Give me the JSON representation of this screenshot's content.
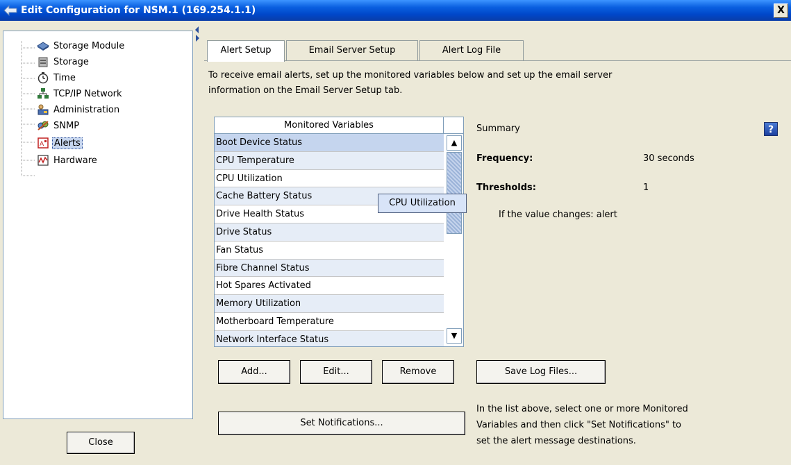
{
  "window": {
    "title": "Edit Configuration for NSM.1 (169.254.1.1)",
    "close_glyph": "X"
  },
  "tree": {
    "items": [
      {
        "label": "Storage Module",
        "icon": "storage-module-icon"
      },
      {
        "label": "Storage",
        "icon": "storage-icon"
      },
      {
        "label": "Time",
        "icon": "clock-icon"
      },
      {
        "label": "TCP/IP Network",
        "icon": "network-icon"
      },
      {
        "label": "Administration",
        "icon": "administration-icon"
      },
      {
        "label": "SNMP",
        "icon": "snmp-icon"
      },
      {
        "label": "Alerts",
        "icon": "alerts-icon",
        "selected": true
      },
      {
        "label": "Hardware",
        "icon": "hardware-icon"
      }
    ]
  },
  "close_button": "Close",
  "tabs": [
    {
      "label": "Alert Setup",
      "active": true
    },
    {
      "label": "Email Server Setup",
      "active": false
    },
    {
      "label": "Alert Log File",
      "active": false
    }
  ],
  "alert_setup": {
    "intro_line1": "To receive email alerts, set up the monitored variables below and set up the email server",
    "intro_line2": "information on the Email Server Setup tab.",
    "list_header": "Monitored Variables",
    "variables": [
      "Boot Device Status",
      "CPU Temperature",
      "CPU Utilization",
      "Cache Battery Status",
      "Drive Health Status",
      "Drive Status",
      "Fan Status",
      "Fibre Channel Status",
      "Hot Spares Activated",
      "Memory Utilization",
      "Motherboard Temperature",
      "Network Interface Status"
    ],
    "selected_variable": "Boot Device Status",
    "tooltip": "CPU Utilization",
    "summary": {
      "heading": "Summary",
      "frequency_label": "Frequency:",
      "frequency_value": "30 seconds",
      "thresholds_label": "Thresholds:",
      "thresholds_value": "1",
      "threshold_rule": "If the value changes: alert"
    },
    "buttons": {
      "add": "Add...",
      "edit": "Edit...",
      "remove": "Remove",
      "save_log": "Save Log Files...",
      "set_notifications": "Set Notifications..."
    },
    "note_line1": "In the list above, select one or more Monitored",
    "note_line2": "Variables and then click \"Set Notifications\" to",
    "note_line3": "set the alert message destinations."
  },
  "colors": {
    "title_bar": "#0a5fe0",
    "selection": "#c5d5ee",
    "alt_row": "#e6edf7"
  }
}
